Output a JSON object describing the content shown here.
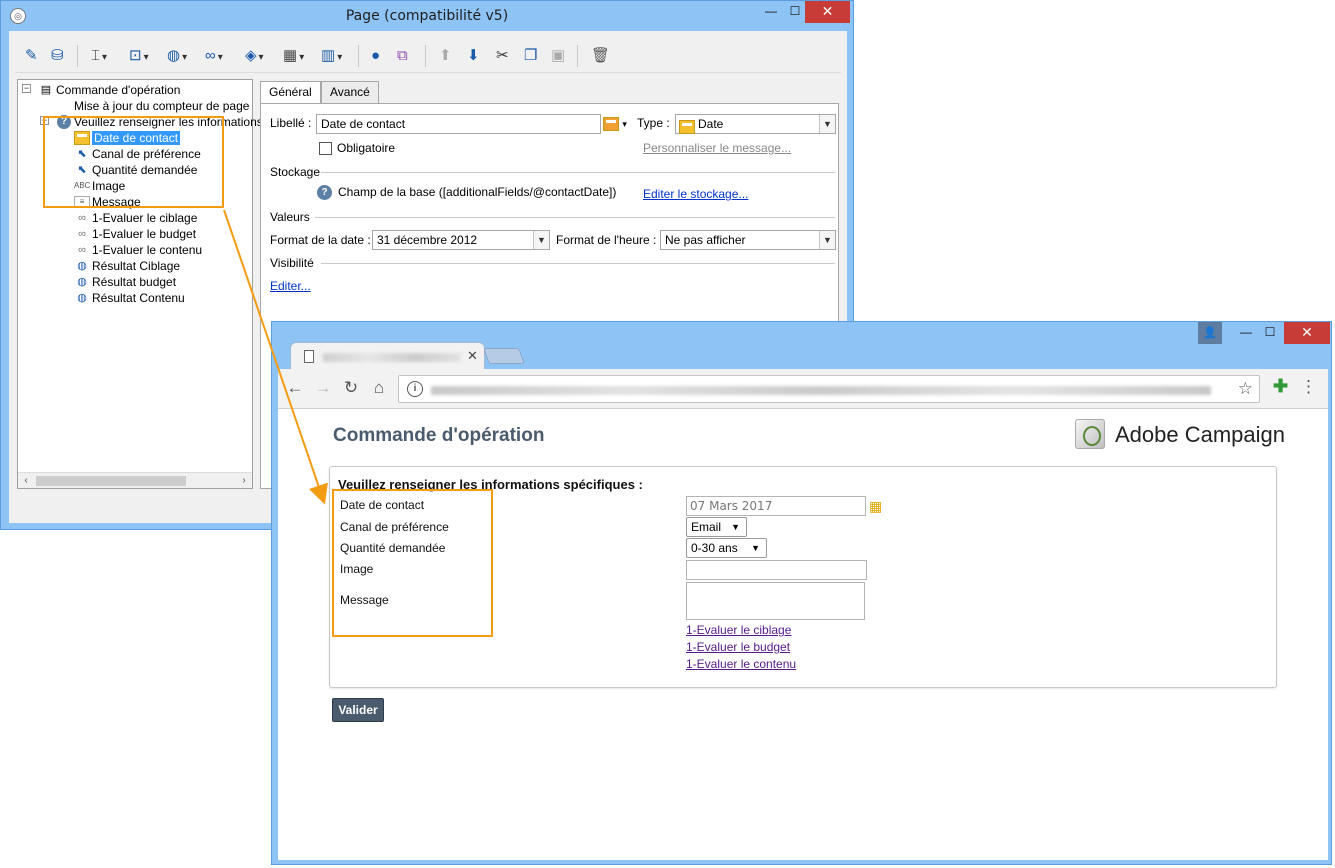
{
  "editor": {
    "window_title": "Page (compatibilité v5)",
    "window_icon": "app-logo-icon",
    "tree": {
      "root": "Commande d'opération",
      "items": [
        "Mise à jour du compteur de page",
        "Veuillez renseigner les informations",
        "Date de contact",
        "Canal de préférence",
        "Quantité demandée",
        "Image",
        "Message",
        "1-Evaluer le ciblage",
        "1-Evaluer le budget",
        "1-Evaluer le contenu",
        "Résultat Ciblage",
        "Résultat budget",
        "Résultat Contenu"
      ],
      "selected": "Date de contact",
      "abc_glyph": "ABC"
    },
    "tabs": [
      "Général",
      "Avancé"
    ],
    "form": {
      "label_caption": "Libellé :",
      "label_value": "Date de contact",
      "type_caption": "Type :",
      "type_value": "Date",
      "mandatory": "Obligatoire",
      "custom_message_link": "Personnaliser le message...",
      "storage_section": "Stockage",
      "storage_field": "Champ de la base ([additionalFields/@contactDate])",
      "storage_link": "Editer le stockage...",
      "values_section": "Valeurs",
      "date_format_caption": "Format de la date :",
      "date_format_value": "31 décembre 2012",
      "time_format_caption": "Format de l'heure :",
      "time_format_value": "Ne pas afficher",
      "visibility_section": "Visibilité",
      "visibility_link": "Editer..."
    }
  },
  "browser": {
    "page_title": "Commande d'opération",
    "brand": "Adobe Campaign",
    "form_header": "Veuillez renseigner les informations spécifiques :",
    "fields": {
      "contact_date_label": "Date de contact",
      "contact_date_value": "07 Mars 2017",
      "channel_label": "Canal de préférence",
      "channel_value": "Email",
      "quantity_label": "Quantité demandée",
      "quantity_value": "0-30 ans",
      "image_label": "Image",
      "message_label": "Message"
    },
    "links": [
      "1-Evaluer le ciblage",
      "1-Evaluer le budget",
      "1-Evaluer le contenu"
    ],
    "submit": "Valider"
  },
  "colors": {
    "window_frame": "#8ec3f5",
    "close_button": "#c73c36",
    "selection": "#3399ff",
    "highlight": "#f39c12",
    "submit_button": "#4a5b6e"
  }
}
